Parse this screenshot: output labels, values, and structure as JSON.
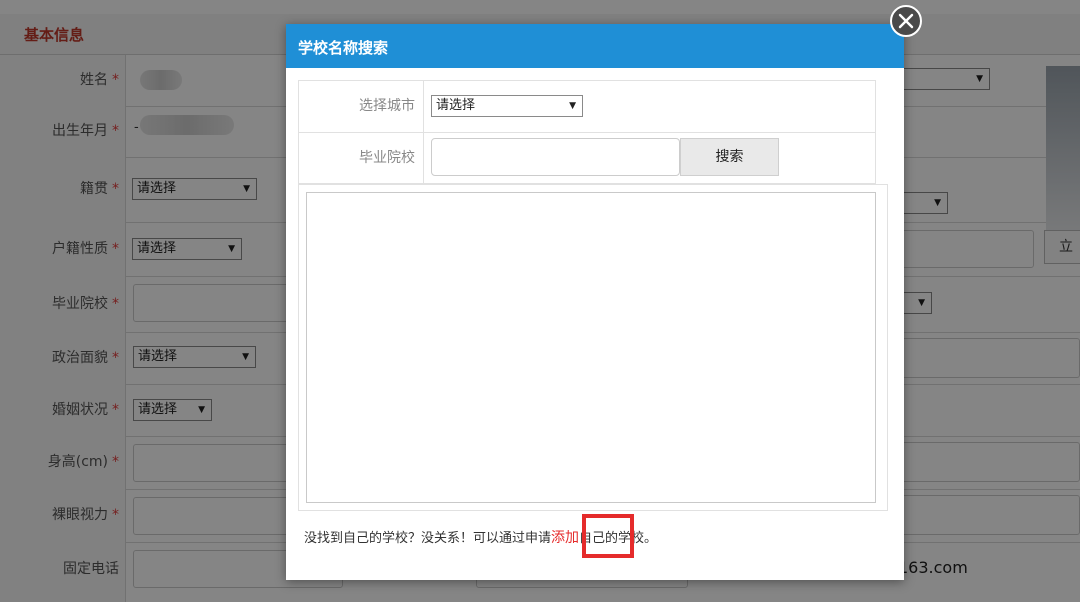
{
  "section": {
    "title": "基本信息"
  },
  "form": {
    "rows": [
      {
        "label": "姓名",
        "required": true
      },
      {
        "label": "出生年月",
        "required": true
      },
      {
        "label": "籍贯",
        "required": true,
        "select": "请选择"
      },
      {
        "label": "户籍性质",
        "required": true,
        "select": "请选择"
      },
      {
        "label": "毕业院校",
        "required": true
      },
      {
        "label": "政治面貌",
        "required": true,
        "select": "请选择"
      },
      {
        "label": "婚姻状况",
        "required": true,
        "select": "请选择"
      },
      {
        "label": "身高(cm)",
        "required": true
      },
      {
        "label": "裸眼视力",
        "required": true
      },
      {
        "label": "固定电话",
        "required": false
      }
    ],
    "required_mark": "*",
    "right_button_label": "立",
    "email_fragment": "163.com",
    "birth_fragment": "-"
  },
  "modal": {
    "title": "学校名称搜索",
    "city_label": "选择城市",
    "city_select": "请选择",
    "school_label": "毕业院校",
    "school_placeholder": "",
    "search_button": "搜索",
    "footer_prefix": "没找到自己的学校？没关系！可以通过申请",
    "footer_link": "添加",
    "footer_suffix": "自己的学校。",
    "close_icon": "close-icon"
  },
  "colors": {
    "header": "#1f8fd6",
    "required": "#e23c3c",
    "highlight": "#e52b2b"
  }
}
